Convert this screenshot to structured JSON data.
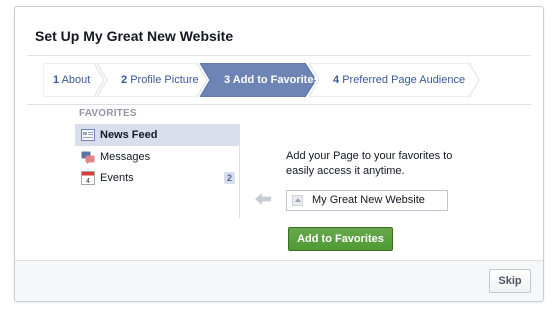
{
  "dialog": {
    "title": "Set Up My Great New Website",
    "steps": [
      {
        "number": "1",
        "label": "About",
        "active": false
      },
      {
        "number": "2",
        "label": "Profile Picture",
        "active": false
      },
      {
        "number": "3",
        "label": "Add to Favorites",
        "active": true
      },
      {
        "number": "4",
        "label": "Preferred Page Audience",
        "active": false
      }
    ],
    "favorites": {
      "heading": "FAVORITES",
      "items": [
        {
          "label": "News Feed",
          "icon": "news-feed-icon",
          "selected": true
        },
        {
          "label": "Messages",
          "icon": "messages-icon"
        },
        {
          "label": "Events",
          "icon": "events-icon",
          "count": "2",
          "icon_text": "4"
        }
      ]
    },
    "panel": {
      "instruction": "Add your Page to your favorites to easily access it anytime.",
      "page_name": "My Great New Website",
      "add_button": "Add to Favorites"
    },
    "footer": {
      "skip_button": "Skip"
    }
  },
  "colors": {
    "active_step": "#6d84b4",
    "link_blue": "#3b5998",
    "selected_item": "#d8dfea",
    "green_button": "#5b9e3d"
  }
}
